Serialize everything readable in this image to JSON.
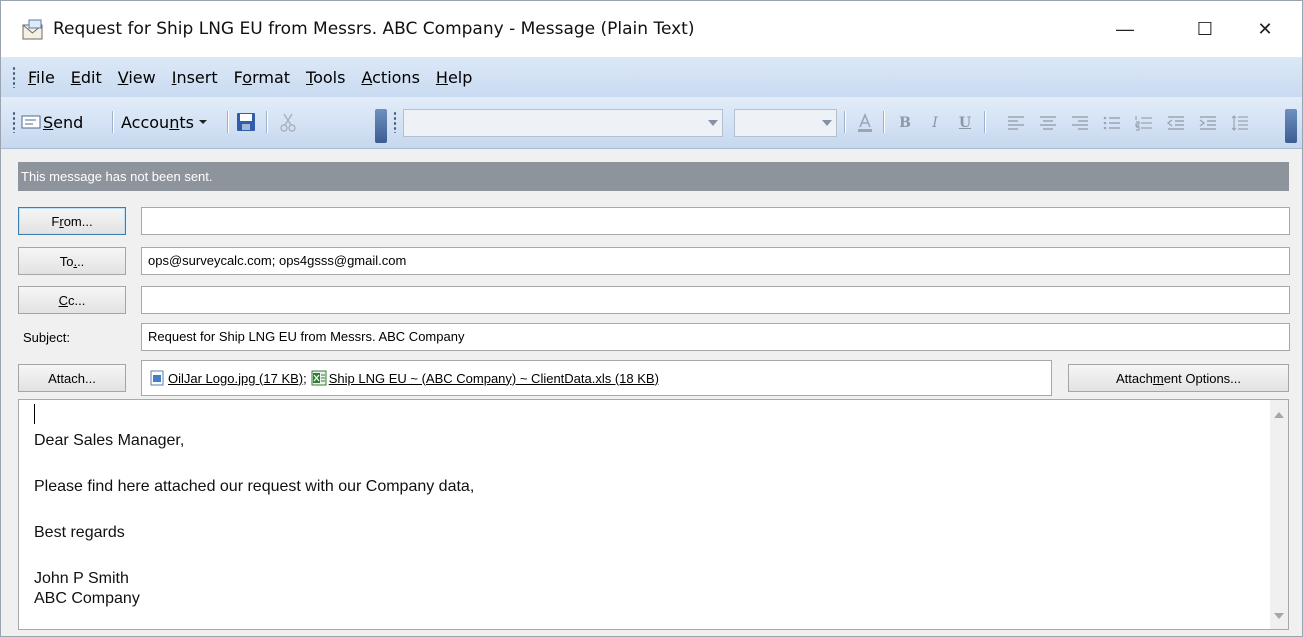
{
  "window": {
    "title": "Request for Ship LNG EU from Messrs. ABC Company - Message (Plain Text)",
    "controls": {
      "minimize": "—",
      "maximize": "☐",
      "close": "✕"
    }
  },
  "menu": {
    "items": [
      {
        "pre": "",
        "key": "F",
        "post": "ile"
      },
      {
        "pre": "",
        "key": "E",
        "post": "dit"
      },
      {
        "pre": "",
        "key": "V",
        "post": "iew"
      },
      {
        "pre": "",
        "key": "I",
        "post": "nsert"
      },
      {
        "pre": "F",
        "key": "o",
        "post": "rmat"
      },
      {
        "pre": "",
        "key": "T",
        "post": "ools"
      },
      {
        "pre": "",
        "key": "A",
        "post": "ctions"
      },
      {
        "pre": "",
        "key": "H",
        "post": "elp"
      }
    ]
  },
  "toolbar": {
    "send": {
      "pre": "",
      "key": "S",
      "post": "end"
    },
    "accounts": {
      "pre": "Accou",
      "key": "n",
      "post": "ts"
    },
    "font_value": "",
    "size_value": "",
    "format_buttons": [
      "A",
      "B",
      "I",
      "U"
    ],
    "icons": [
      "send-icon",
      "accounts-dropdown-icon",
      "save-icon",
      "cut-icon",
      "font-color-icon",
      "bold-icon",
      "italic-icon",
      "underline-icon",
      "align-left-icon",
      "align-center-icon",
      "align-right-icon",
      "bullets-icon",
      "numbering-icon",
      "decrease-indent-icon",
      "increase-indent-icon",
      "line-spacing-icon"
    ]
  },
  "infobar": {
    "text": "This message has not been sent."
  },
  "header": {
    "from": {
      "pre": "F",
      "key": "r",
      "post": "om...",
      "value": ""
    },
    "to": {
      "pre": "To",
      "key": ".",
      "post": "..",
      "value": "ops@surveycalc.com; ops4gsss@gmail.com"
    },
    "cc": {
      "pre": "",
      "key": "C",
      "post": "c...",
      "value": ""
    },
    "subject": {
      "pre": "Sub",
      "key": "j",
      "post": "ect:",
      "value": "Request for Ship LNG EU from Messrs. ABC Company"
    },
    "attach": {
      "label": "Attach...",
      "files": [
        {
          "name": "OilJar Logo.jpg (17 KB)",
          "icon": "image-file-icon"
        },
        {
          "name": "Ship LNG EU ~ (ABC Company) ~ ClientData.xls (18 KB)",
          "icon": "excel-file-icon"
        }
      ],
      "separator": ";",
      "options": {
        "pre": "Attach",
        "key": "m",
        "post": "ent Options..."
      }
    }
  },
  "body": {
    "lines": [
      "Dear Sales Manager,",
      "Please find here attached our request with our Company data,",
      "Best regards",
      "John P Smith",
      "ABC Company"
    ]
  }
}
